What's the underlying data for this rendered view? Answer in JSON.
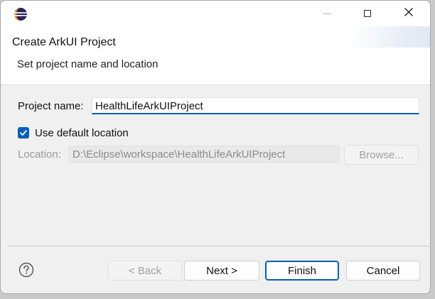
{
  "window": {
    "title_icon": "eclipse-icon",
    "controls": {
      "minimize": "minimize-icon",
      "maximize": "maximize-icon",
      "close": "close-icon"
    }
  },
  "wizard": {
    "title": "Create ArkUI Project",
    "description": "Set project name and location"
  },
  "form": {
    "project_name_label": "Project name:",
    "project_name_value": "HealthLifeArkUIProject",
    "use_default_location_label": "Use default location",
    "use_default_location_checked": true,
    "location_label": "Location:",
    "location_value": "D:\\Eclipse\\workspace\\HealthLifeArkUIProject",
    "browse_label": "Browse..."
  },
  "footer": {
    "back_label": "< Back",
    "next_label": "Next >",
    "finish_label": "Finish",
    "cancel_label": "Cancel"
  },
  "colors": {
    "accent": "#005fb8",
    "disabled_text": "#9a9a9a",
    "dialog_bg": "#f0f0f0"
  }
}
